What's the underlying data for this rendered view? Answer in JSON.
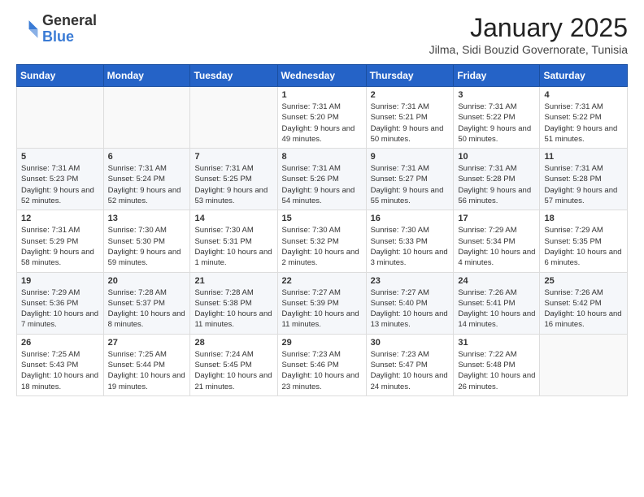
{
  "header": {
    "logo_general": "General",
    "logo_blue": "Blue",
    "month_title": "January 2025",
    "subtitle": "Jilma, Sidi Bouzid Governorate, Tunisia"
  },
  "days_of_week": [
    "Sunday",
    "Monday",
    "Tuesday",
    "Wednesday",
    "Thursday",
    "Friday",
    "Saturday"
  ],
  "weeks": [
    [
      {
        "day": "",
        "sunrise": "",
        "sunset": "",
        "daylight": ""
      },
      {
        "day": "",
        "sunrise": "",
        "sunset": "",
        "daylight": ""
      },
      {
        "day": "",
        "sunrise": "",
        "sunset": "",
        "daylight": ""
      },
      {
        "day": "1",
        "sunrise": "Sunrise: 7:31 AM",
        "sunset": "Sunset: 5:20 PM",
        "daylight": "Daylight: 9 hours and 49 minutes."
      },
      {
        "day": "2",
        "sunrise": "Sunrise: 7:31 AM",
        "sunset": "Sunset: 5:21 PM",
        "daylight": "Daylight: 9 hours and 50 minutes."
      },
      {
        "day": "3",
        "sunrise": "Sunrise: 7:31 AM",
        "sunset": "Sunset: 5:22 PM",
        "daylight": "Daylight: 9 hours and 50 minutes."
      },
      {
        "day": "4",
        "sunrise": "Sunrise: 7:31 AM",
        "sunset": "Sunset: 5:22 PM",
        "daylight": "Daylight: 9 hours and 51 minutes."
      }
    ],
    [
      {
        "day": "5",
        "sunrise": "Sunrise: 7:31 AM",
        "sunset": "Sunset: 5:23 PM",
        "daylight": "Daylight: 9 hours and 52 minutes."
      },
      {
        "day": "6",
        "sunrise": "Sunrise: 7:31 AM",
        "sunset": "Sunset: 5:24 PM",
        "daylight": "Daylight: 9 hours and 52 minutes."
      },
      {
        "day": "7",
        "sunrise": "Sunrise: 7:31 AM",
        "sunset": "Sunset: 5:25 PM",
        "daylight": "Daylight: 9 hours and 53 minutes."
      },
      {
        "day": "8",
        "sunrise": "Sunrise: 7:31 AM",
        "sunset": "Sunset: 5:26 PM",
        "daylight": "Daylight: 9 hours and 54 minutes."
      },
      {
        "day": "9",
        "sunrise": "Sunrise: 7:31 AM",
        "sunset": "Sunset: 5:27 PM",
        "daylight": "Daylight: 9 hours and 55 minutes."
      },
      {
        "day": "10",
        "sunrise": "Sunrise: 7:31 AM",
        "sunset": "Sunset: 5:28 PM",
        "daylight": "Daylight: 9 hours and 56 minutes."
      },
      {
        "day": "11",
        "sunrise": "Sunrise: 7:31 AM",
        "sunset": "Sunset: 5:28 PM",
        "daylight": "Daylight: 9 hours and 57 minutes."
      }
    ],
    [
      {
        "day": "12",
        "sunrise": "Sunrise: 7:31 AM",
        "sunset": "Sunset: 5:29 PM",
        "daylight": "Daylight: 9 hours and 58 minutes."
      },
      {
        "day": "13",
        "sunrise": "Sunrise: 7:30 AM",
        "sunset": "Sunset: 5:30 PM",
        "daylight": "Daylight: 9 hours and 59 minutes."
      },
      {
        "day": "14",
        "sunrise": "Sunrise: 7:30 AM",
        "sunset": "Sunset: 5:31 PM",
        "daylight": "Daylight: 10 hours and 1 minute."
      },
      {
        "day": "15",
        "sunrise": "Sunrise: 7:30 AM",
        "sunset": "Sunset: 5:32 PM",
        "daylight": "Daylight: 10 hours and 2 minutes."
      },
      {
        "day": "16",
        "sunrise": "Sunrise: 7:30 AM",
        "sunset": "Sunset: 5:33 PM",
        "daylight": "Daylight: 10 hours and 3 minutes."
      },
      {
        "day": "17",
        "sunrise": "Sunrise: 7:29 AM",
        "sunset": "Sunset: 5:34 PM",
        "daylight": "Daylight: 10 hours and 4 minutes."
      },
      {
        "day": "18",
        "sunrise": "Sunrise: 7:29 AM",
        "sunset": "Sunset: 5:35 PM",
        "daylight": "Daylight: 10 hours and 6 minutes."
      }
    ],
    [
      {
        "day": "19",
        "sunrise": "Sunrise: 7:29 AM",
        "sunset": "Sunset: 5:36 PM",
        "daylight": "Daylight: 10 hours and 7 minutes."
      },
      {
        "day": "20",
        "sunrise": "Sunrise: 7:28 AM",
        "sunset": "Sunset: 5:37 PM",
        "daylight": "Daylight: 10 hours and 8 minutes."
      },
      {
        "day": "21",
        "sunrise": "Sunrise: 7:28 AM",
        "sunset": "Sunset: 5:38 PM",
        "daylight": "Daylight: 10 hours and 11 minutes."
      },
      {
        "day": "22",
        "sunrise": "Sunrise: 7:27 AM",
        "sunset": "Sunset: 5:39 PM",
        "daylight": "Daylight: 10 hours and 11 minutes."
      },
      {
        "day": "23",
        "sunrise": "Sunrise: 7:27 AM",
        "sunset": "Sunset: 5:40 PM",
        "daylight": "Daylight: 10 hours and 13 minutes."
      },
      {
        "day": "24",
        "sunrise": "Sunrise: 7:26 AM",
        "sunset": "Sunset: 5:41 PM",
        "daylight": "Daylight: 10 hours and 14 minutes."
      },
      {
        "day": "25",
        "sunrise": "Sunrise: 7:26 AM",
        "sunset": "Sunset: 5:42 PM",
        "daylight": "Daylight: 10 hours and 16 minutes."
      }
    ],
    [
      {
        "day": "26",
        "sunrise": "Sunrise: 7:25 AM",
        "sunset": "Sunset: 5:43 PM",
        "daylight": "Daylight: 10 hours and 18 minutes."
      },
      {
        "day": "27",
        "sunrise": "Sunrise: 7:25 AM",
        "sunset": "Sunset: 5:44 PM",
        "daylight": "Daylight: 10 hours and 19 minutes."
      },
      {
        "day": "28",
        "sunrise": "Sunrise: 7:24 AM",
        "sunset": "Sunset: 5:45 PM",
        "daylight": "Daylight: 10 hours and 21 minutes."
      },
      {
        "day": "29",
        "sunrise": "Sunrise: 7:23 AM",
        "sunset": "Sunset: 5:46 PM",
        "daylight": "Daylight: 10 hours and 23 minutes."
      },
      {
        "day": "30",
        "sunrise": "Sunrise: 7:23 AM",
        "sunset": "Sunset: 5:47 PM",
        "daylight": "Daylight: 10 hours and 24 minutes."
      },
      {
        "day": "31",
        "sunrise": "Sunrise: 7:22 AM",
        "sunset": "Sunset: 5:48 PM",
        "daylight": "Daylight: 10 hours and 26 minutes."
      },
      {
        "day": "",
        "sunrise": "",
        "sunset": "",
        "daylight": ""
      }
    ]
  ]
}
